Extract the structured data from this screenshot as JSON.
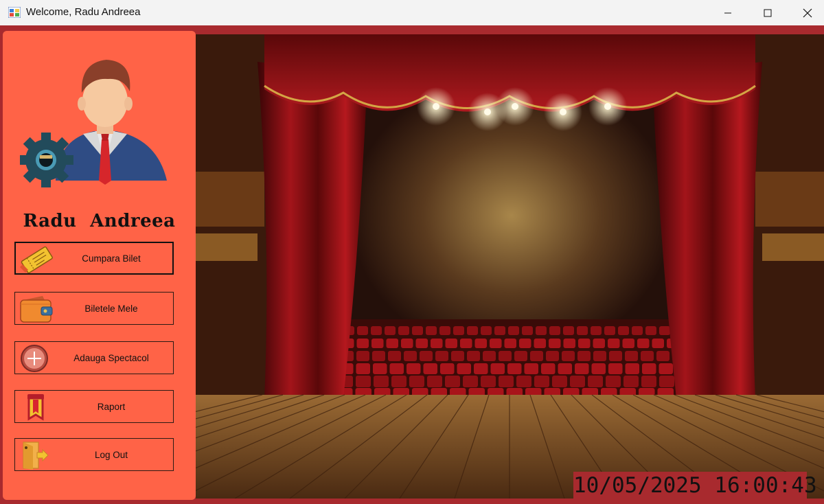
{
  "window": {
    "title": "Welcome, Radu Andreea",
    "controls": [
      "minimize",
      "maximize",
      "close"
    ]
  },
  "sidebar": {
    "user_name": "Radu Andreea",
    "avatar_icon": "user-avatar-with-gear-icon",
    "buttons": [
      {
        "label": "Cumpara Bilet",
        "icon": "ticket-icon",
        "active": true
      },
      {
        "label": "Biletele Mele",
        "icon": "wallet-icon",
        "active": false
      },
      {
        "label": "Adauga Spectacol",
        "icon": "add-circle-icon",
        "active": false
      },
      {
        "label": "Raport",
        "icon": "bookmark-report-icon",
        "active": false
      },
      {
        "label": "Log Out",
        "icon": "exit-door-icon",
        "active": false
      }
    ]
  },
  "main": {
    "background": "theater-stage-image",
    "clock": "10/05/2025 16:00:43"
  },
  "colors": {
    "sidebar": "#ff6347",
    "frame": "#a82a2e",
    "titlebar": "#f3f3f3"
  }
}
